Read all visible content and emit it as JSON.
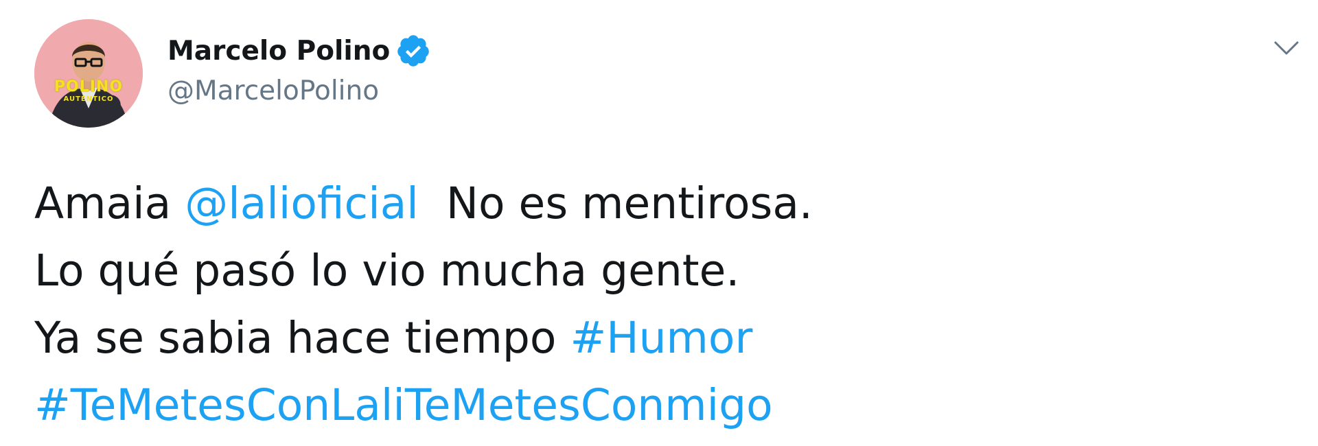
{
  "tweet": {
    "author": {
      "name": "Marcelo Polino",
      "handle": "@MarceloPolino",
      "verified": true,
      "avatar_text": [
        "POLINO",
        "AUTÉNTICO"
      ]
    },
    "text": {
      "line1": {
        "before": "Amaia ",
        "mention": "@lalioficial",
        "after": "  No es mentirosa."
      },
      "line2": "Lo qué pasó lo vio mucha gente.",
      "line3": {
        "before": "Ya se sabia hace tiempo ",
        "hashtag": "#Humor"
      },
      "line4": {
        "hashtag": "#TeMetesConLaliTeMetesConmigo"
      }
    },
    "colors": {
      "link": "#1da1f2",
      "text": "#14171a",
      "secondary": "#657786",
      "verified": "#1da1f2",
      "avatar_bg": "#f0a9ad"
    },
    "icons": {
      "verified": "verified-badge-icon",
      "menu": "chevron-down-icon"
    }
  }
}
